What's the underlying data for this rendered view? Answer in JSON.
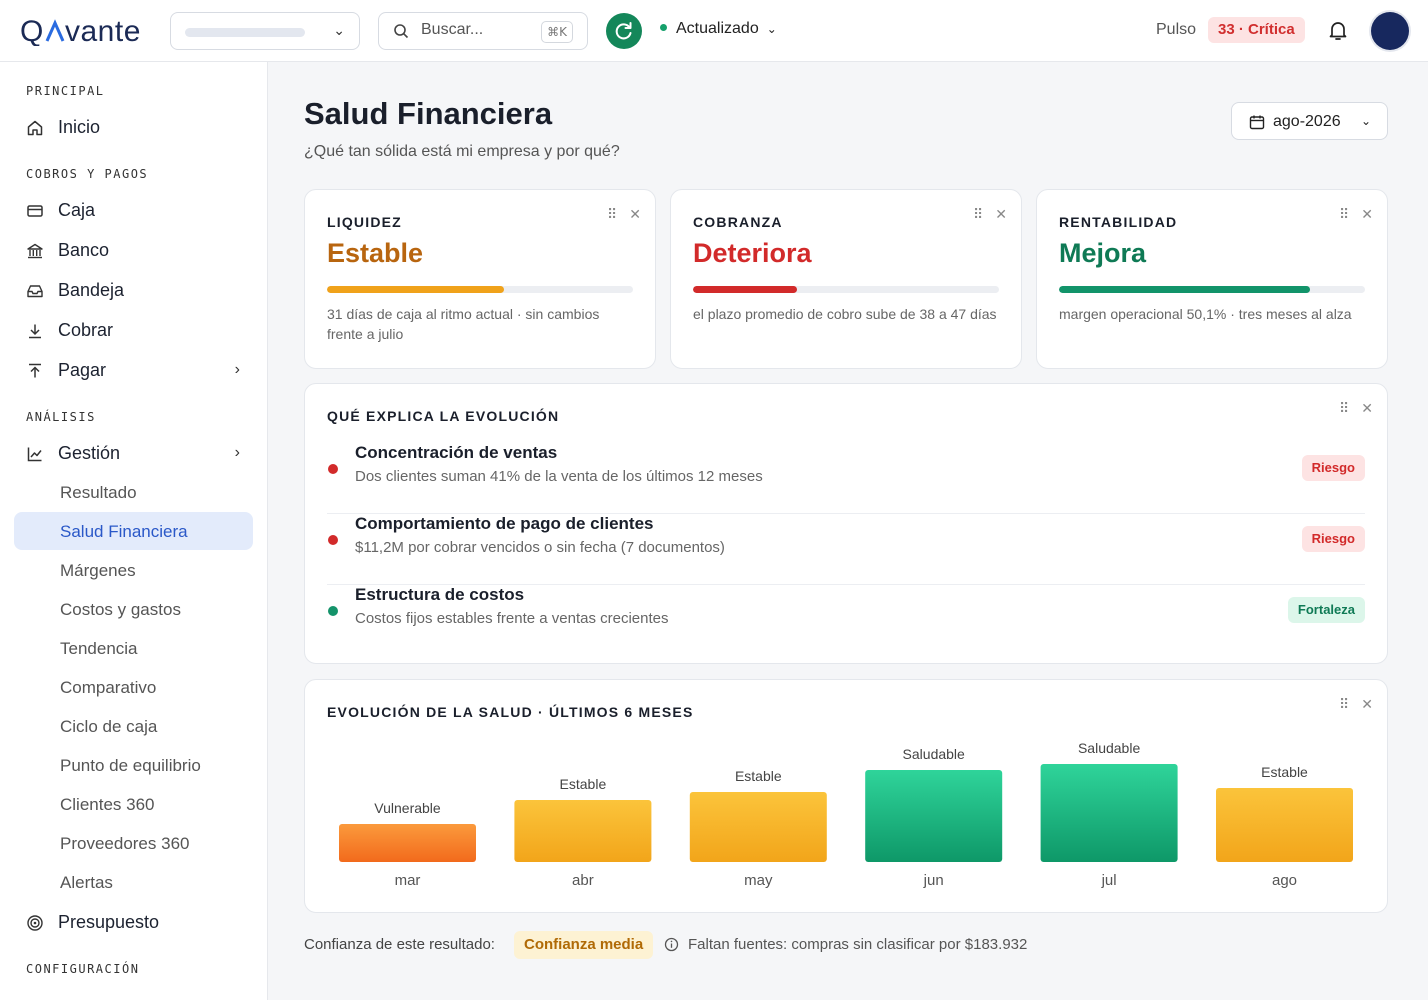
{
  "header": {
    "logo": "QAVANTE",
    "search_placeholder": "Buscar...",
    "search_shortcut": "⌘K",
    "status_label": "Actualizado",
    "pulso_label": "Pulso",
    "pulso_badge": "33 · Crítica"
  },
  "sidebar": {
    "sections": {
      "principal": "PRINCIPAL",
      "cobros": "COBROS Y PAGOS",
      "analisis": "ANÁLISIS",
      "config": "CONFIGURACIÓN"
    },
    "items": {
      "inicio": "Inicio",
      "caja": "Caja",
      "banco": "Banco",
      "bandeja": "Bandeja",
      "cobrar": "Cobrar",
      "pagar": "Pagar",
      "gestion": "Gestión",
      "presupuesto": "Presupuesto"
    },
    "subitems": [
      "Resultado",
      "Salud Financiera",
      "Márgenes",
      "Costos y gastos",
      "Tendencia",
      "Comparativo",
      "Ciclo de caja",
      "Punto de equilibrio",
      "Clientes 360",
      "Proveedores 360",
      "Alertas"
    ],
    "active_subitem": "Salud Financiera"
  },
  "page": {
    "title": "Salud Financiera",
    "subtitle": "¿Qué tan sólida está mi empresa y por qué?",
    "period": "ago-2026"
  },
  "kpis": [
    {
      "label": "LIQUIDEZ",
      "value": "Estable",
      "color": "#b8650f",
      "bar_color": "#f0a21a",
      "level": 0.58,
      "desc": "31 días de caja al ritmo actual · sin cambios frente a julio"
    },
    {
      "label": "COBRANZA",
      "value": "Deteriora",
      "color": "#d22a2a",
      "bar_color": "#d22a2a",
      "level": 0.34,
      "desc": "el plazo promedio de cobro sube de 38 a 47 días"
    },
    {
      "label": "RENTABILIDAD",
      "value": "Mejora",
      "color": "#0f7a55",
      "bar_color": "#12946a",
      "level": 0.82,
      "desc": "margen operacional 50,1% · tres meses al alza"
    }
  ],
  "factors": {
    "title": "QUÉ EXPLICA LA EVOLUCIÓN",
    "items": [
      {
        "title": "Concentración de ventas",
        "desc": "Dos clientes suman 41% de la venta de los últimos 12 meses",
        "tag": "Riesgo",
        "dot_color": "#d22a2a",
        "tag_bg": "#fde3e3",
        "tag_color": "#d22a2a"
      },
      {
        "title": "Comportamiento de pago de clientes",
        "desc": "$11,2M por cobrar vencidos o sin fecha (7 documentos)",
        "tag": "Riesgo",
        "dot_color": "#d22a2a",
        "tag_bg": "#fde3e3",
        "tag_color": "#d22a2a"
      },
      {
        "title": "Estructura de costos",
        "desc": "Costos fijos estables frente a ventas crecientes",
        "tag": "Fortaleza",
        "dot_color": "#14936a",
        "tag_bg": "#dcf6ea",
        "tag_color": "#0f7a55"
      }
    ]
  },
  "chart": {
    "title": "EVOLUCIÓN DE LA SALUD · ÚLTIMOS 6 MESES"
  },
  "chart_data": {
    "type": "bar",
    "categories": [
      "mar",
      "abr",
      "may",
      "jun",
      "jul",
      "ago"
    ],
    "values": [
      0.38,
      0.62,
      0.7,
      0.92,
      0.98,
      0.74
    ],
    "labels": [
      "Vulnerable",
      "Estable",
      "Estable",
      "Saludable",
      "Saludable",
      "Estable"
    ],
    "colors": {
      "Vulnerable": [
        "#fb9a3c",
        "#f26a1c"
      ],
      "Estable": [
        "#fbc43b",
        "#f2a51a"
      ],
      "Saludable": [
        "#2fd49a",
        "#0e9868"
      ]
    },
    "xlabel": "",
    "ylabel": ""
  },
  "footer": {
    "confidence_label": "Confianza de este resultado:",
    "confidence_value": "Confianza media",
    "missing_sources": "Faltan fuentes: compras sin clasificar por $183.932"
  }
}
